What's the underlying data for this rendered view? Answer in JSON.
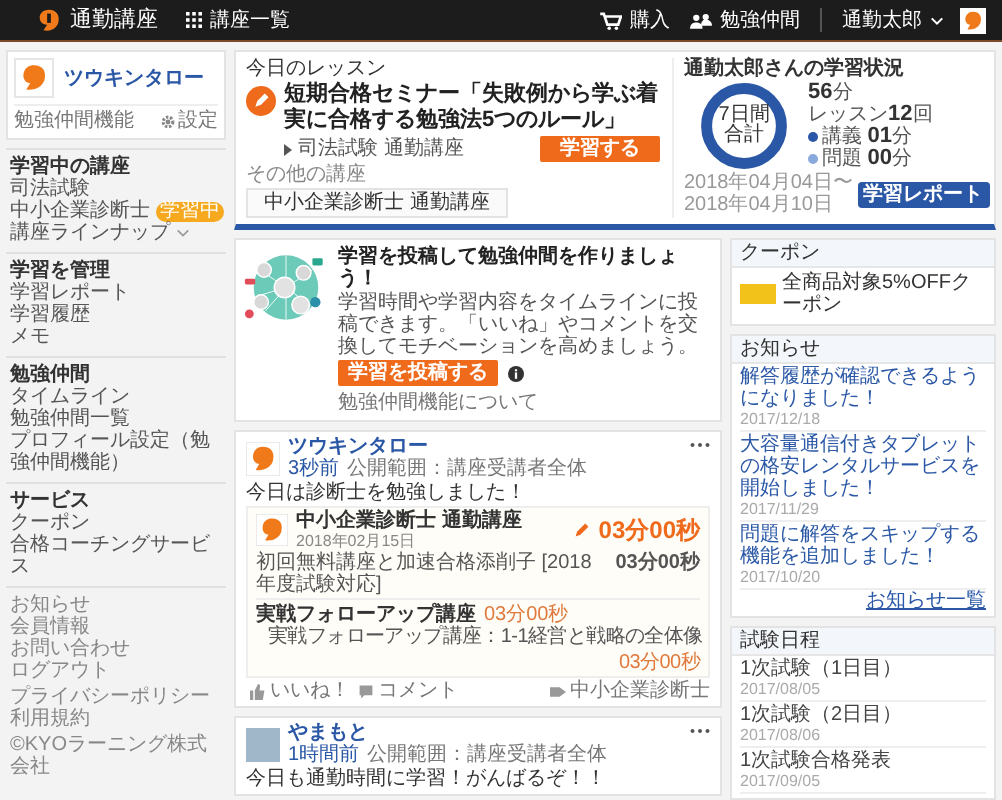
{
  "header": {
    "logo_text": "通勤講座",
    "menu_label": "講座一覧",
    "purchase": "購入",
    "buddies": "勉強仲間",
    "user_name": "通勤太郎"
  },
  "profile": {
    "name": "ツウキンタロー",
    "feature": "勉強仲間機能",
    "settings": "設定"
  },
  "sidebar": {
    "sections": [
      {
        "title": "学習中の講座",
        "items": [
          {
            "label": "司法試験"
          },
          {
            "label": "中小企業診断士",
            "badge": "学習中"
          },
          {
            "label": "講座ラインナップ",
            "kind": "expander",
            "expanded": false
          }
        ]
      },
      {
        "title": "学習を管理",
        "items": [
          {
            "label": "学習レポート"
          },
          {
            "label": "学習履歴"
          },
          {
            "label": "メモ"
          }
        ]
      },
      {
        "title": "勉強仲間",
        "items": [
          {
            "label": "タイムライン"
          },
          {
            "label": "勉強仲間一覧"
          },
          {
            "label": "プロフィール設定（勉強仲間機能）"
          }
        ]
      },
      {
        "title": "サービス",
        "items": [
          {
            "label": "クーポン"
          },
          {
            "label": "合格コーチングサービス"
          }
        ]
      }
    ],
    "links": [
      "お知らせ",
      "会員情報",
      "お問い合わせ",
      "ログアウト"
    ],
    "legal": [
      "プライバシーポリシー",
      "利用規約"
    ],
    "copyright": "©KYOラーニング株式会社"
  },
  "lesson": {
    "heading": "今日のレッスン",
    "title": "短期合格セミナー「失敗例から学ぶ着実に合格する勉強法5つのルール」",
    "course": "司法試験 通勤講座",
    "button": "学習する",
    "other_heading": "その他の講座",
    "other_course": "中小企業診断士 通勤講座"
  },
  "status": {
    "title": "通勤太郎さんの学習状況",
    "donut_label": "7日間合計",
    "total": {
      "value": "56",
      "unit": "分"
    },
    "lessons": {
      "label": "レッスン",
      "value": "12",
      "unit": "回"
    },
    "breakdown": [
      {
        "label": "講義",
        "value": "01",
        "unit": "分",
        "color": "#2b58a6"
      },
      {
        "label": "問題",
        "value": "00",
        "unit": "分",
        "color": "#8aa9dc"
      }
    ],
    "date_from": "2018年04月04日〜",
    "date_to": "2018年04月10日",
    "button": "学習レポート"
  },
  "promo": {
    "title": "学習を投稿して勉強仲間を作りましょう！",
    "text": "学習時間や学習内容をタイムラインに投稿できます。「いいね」やコメントを交換してモチベーションを高めましょう。",
    "button": "学習を投稿する",
    "info_link": "勉強仲間機能について"
  },
  "posts": [
    {
      "kind": "record",
      "author": "ツウキンタロー",
      "time": "3秒前",
      "scope": "公開範囲：講座受講者全体",
      "text": "今日は診断士を勉強しました！",
      "record": {
        "course": "中小企業診断士 通勤講座",
        "date": "2018年02月15日",
        "total": "03分00秒",
        "lines": [
          {
            "label": "初回無料講座と加速合格添削子 [2018年度試験対応]",
            "time": "03分00秒"
          }
        ],
        "followup": {
          "title": "実戦フォローアップ講座",
          "time": "03分00秒",
          "sub_label": "実戦フォローアップ講座：1-1経営と戦略の全体像",
          "sub_time": "03分00秒"
        }
      },
      "like": "いいね！",
      "comment": "コメント",
      "tag": "中小企業診断士"
    },
    {
      "kind": "text",
      "author": "やまもと",
      "time": "1時間前",
      "scope": "公開範囲：講座受講者全体",
      "text": "今日も通勤時間に学習！がんばるぞ！！"
    }
  ],
  "coupon": {
    "heading": "クーポン",
    "text": "全商品対象5%OFFクーポン"
  },
  "news": {
    "heading": "お知らせ",
    "items": [
      {
        "title": "解答履歴が確認できるようになりました！",
        "date": "2017/12/18"
      },
      {
        "title": "大容量通信付きタブレットの格安レンタルサービスを開始しました！",
        "date": "2017/11/29"
      },
      {
        "title": "問題に解答をスキップする機能を追加しました！",
        "date": "2017/10/20"
      }
    ],
    "more": "お知らせ一覧"
  },
  "exams": {
    "heading": "試験日程",
    "items": [
      {
        "title": "1次試験（1日目）",
        "date": "2017/08/05"
      },
      {
        "title": "1次試験（2日目）",
        "date": "2017/08/06"
      },
      {
        "title": "1次試験合格発表",
        "date": "2017/09/05"
      }
    ]
  }
}
